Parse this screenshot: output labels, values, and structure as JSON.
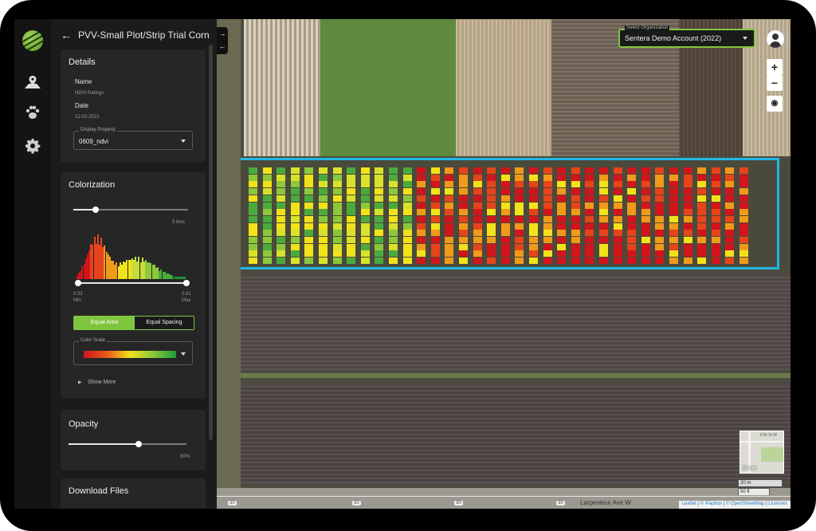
{
  "header": {
    "title": "PVV-Small Plot/Strip Trial Corn"
  },
  "rail": {
    "items": [
      "map-marker-icon",
      "paw-icon",
      "gear-icon"
    ],
    "accent": "#7fc63f"
  },
  "details": {
    "heading": "Details",
    "name_label": "Name",
    "name_value": "NDVI Ratings",
    "date_label": "Date",
    "date_value": "12-02-2021",
    "display_property_legend": "Display Property",
    "display_property_value": "0609_ndvi"
  },
  "colorization": {
    "heading": "Colorization",
    "bins_label": "5 bins",
    "bins_value": 0.22,
    "min_value": "0.33",
    "min_label": "Min",
    "max_value": "0.61",
    "max_label": "Max",
    "toggle_left": "Equal Area",
    "toggle_right": "Equal Spacing",
    "toggle_selected": "Equal Area",
    "color_scale_legend": "Color Scale",
    "show_more": "Show More"
  },
  "opacity": {
    "heading": "Opacity",
    "value_label": "60%",
    "value": 0.6
  },
  "downloads": {
    "heading": "Download Files"
  },
  "map": {
    "org_legend": "Select Organization",
    "org_value": "Sentera Demo Account (2022)",
    "zoom_in": "+",
    "zoom_out": "−",
    "road_markers": [
      "30",
      "30",
      "30",
      "30",
      "30"
    ],
    "street_name": "Larpenteur Ave W",
    "inset_label": "Street",
    "inset_street": "17th St W",
    "scale_m": "20 m",
    "scale_ft": "50 ft",
    "attribution": {
      "leaflet": "Leaflet",
      "mapbox": "© Mapbox",
      "osm": "© OpenStreetMap",
      "licenses": "Licenses"
    }
  },
  "colors": {
    "plot_outline": "#1fb8e6",
    "brand": "#7fc63f"
  }
}
